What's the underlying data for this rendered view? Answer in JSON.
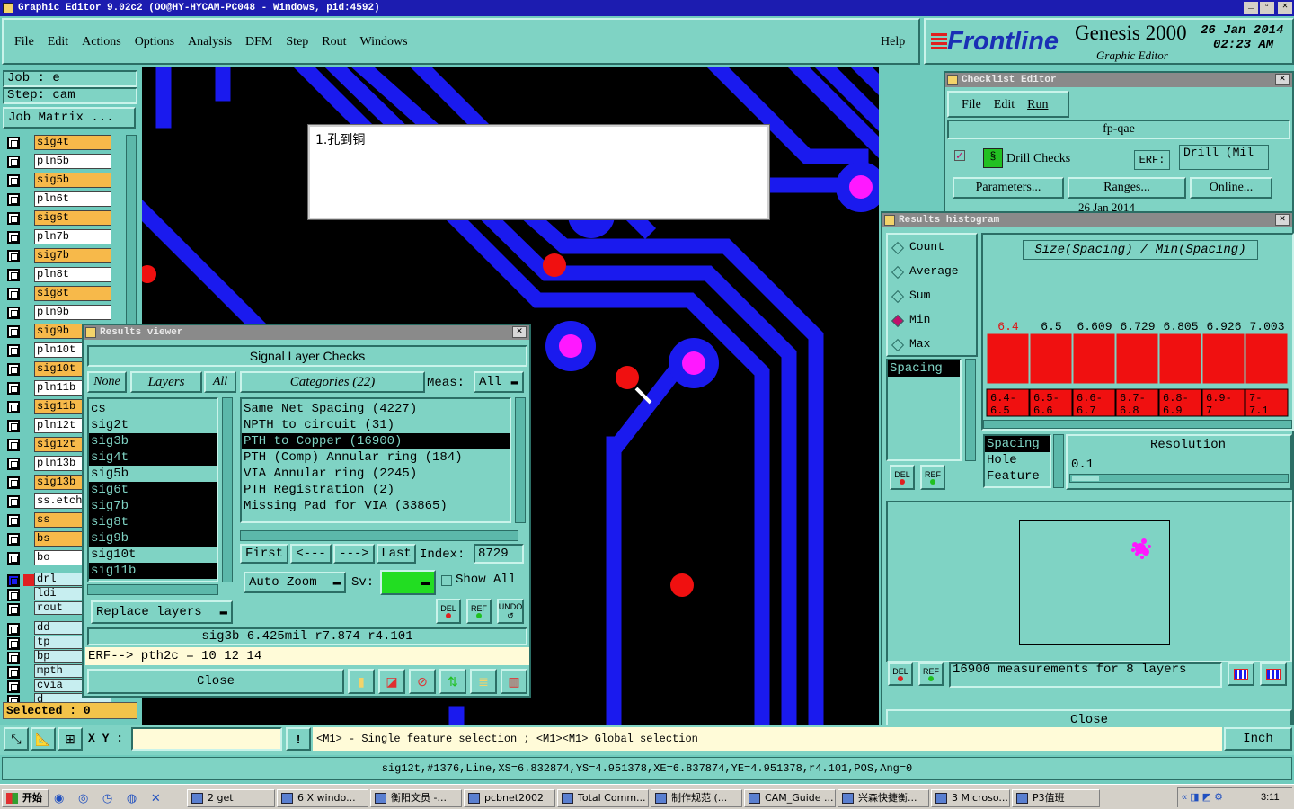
{
  "app_title": "Graphic Editor 9.02c2 (OO@HY-HYCAM-PC048 - Windows, pid:4592)",
  "menu": [
    "File",
    "Edit",
    "Actions",
    "Options",
    "Analysis",
    "DFM",
    "Step",
    "Rout",
    "Windows"
  ],
  "help": "Help",
  "brand": {
    "logo": "Frontline",
    "product": "Genesis 2000",
    "subtitle": "Graphic Editor",
    "date": "26 Jan 2014",
    "time": "02:23 AM"
  },
  "job": {
    "job": "Job  : e",
    "step": "Step: cam",
    "matrix": "Job Matrix ..."
  },
  "layers": [
    {
      "name": "sig4t",
      "aff": true
    },
    {
      "name": "pln5b"
    },
    {
      "name": "sig5b",
      "aff": true
    },
    {
      "name": "pln6t"
    },
    {
      "name": "sig6t",
      "aff": true
    },
    {
      "name": "pln7b"
    },
    {
      "name": "sig7b",
      "aff": true
    },
    {
      "name": "pln8t"
    },
    {
      "name": "sig8t",
      "aff": true
    },
    {
      "name": "pln9b"
    },
    {
      "name": "sig9b",
      "aff": true
    },
    {
      "name": "pln10t"
    },
    {
      "name": "sig10t",
      "aff": true
    },
    {
      "name": "pln11b"
    },
    {
      "name": "sig11b",
      "aff": true
    },
    {
      "name": "pln12t"
    },
    {
      "name": "sig12t",
      "aff": true
    },
    {
      "name": "pln13b"
    },
    {
      "name": "sig13b",
      "aff": true
    },
    {
      "name": "ss.etch"
    },
    {
      "name": "ss",
      "aff": true
    },
    {
      "name": "bs",
      "aff": true
    },
    {
      "name": "bo"
    }
  ],
  "layers2": [
    {
      "name": "drl"
    },
    {
      "name": "ldi"
    },
    {
      "name": "rout"
    },
    {
      "name": "dd"
    },
    {
      "name": "tp"
    },
    {
      "name": "bp"
    },
    {
      "name": "mpth"
    },
    {
      "name": "cvia"
    },
    {
      "name": "d"
    }
  ],
  "selected": "Selected : 0",
  "xy_label": "X Y :",
  "status_msg": "<M1> - Single feature selection ; <M1><M1> Global selection",
  "units": "Inch",
  "feature_line": "sig12t,#1376,Line,XS=6.832874,YS=4.951378,XE=6.837874,YE=4.951378,r4.101,POS,Ang=0",
  "note": "1.孔到铜",
  "results_viewer": {
    "title": "Results viewer",
    "header": "Signal Layer Checks",
    "none": "None",
    "layers": "Layers",
    "all": "All",
    "categories": "Categories (22)",
    "meas": "Meas:",
    "meas_val": "All",
    "layer_list": [
      {
        "n": "cs"
      },
      {
        "n": "sig2t"
      },
      {
        "n": "sig3b",
        "s": true
      },
      {
        "n": "sig4t",
        "s": true
      },
      {
        "n": "sig5b"
      },
      {
        "n": "sig6t",
        "s": true
      },
      {
        "n": "sig7b",
        "s": true
      },
      {
        "n": "sig8t",
        "s": true
      },
      {
        "n": "sig9b",
        "s": true
      },
      {
        "n": "sig10t"
      },
      {
        "n": "sig11b",
        "s": true
      }
    ],
    "cat_list": [
      {
        "n": "Same Net Spacing (4227)"
      },
      {
        "n": "NPTH to circuit (31)"
      },
      {
        "n": "PTH to Copper (16900)",
        "s": true
      },
      {
        "n": "PTH (Comp) Annular ring (184)"
      },
      {
        "n": "VIA Annular ring (2245)"
      },
      {
        "n": "PTH Registration (2)"
      },
      {
        "n": "Missing Pad for VIA (33865)"
      }
    ],
    "first": "First",
    "prev": "<---",
    "next": "--->",
    "last": "Last",
    "index_label": "Index:",
    "index_val": "8729",
    "auto_zoom": "Auto Zoom",
    "sv": "Sv:",
    "show_all": "Show All",
    "replace": "Replace layers",
    "del": "DEL",
    "ref": "REF",
    "undo": "UNDO",
    "info": "sig3b  6.425mil   r7.874   r4.101",
    "erf": "ERF--> pth2c = 10 12 14",
    "close": "Close"
  },
  "checklist": {
    "title": "Checklist Editor",
    "menu": [
      "File",
      "Edit",
      "Run"
    ],
    "name": "fp-qae",
    "check": "Drill Checks",
    "erf": "ERF:",
    "erf_val": "Drill (Mil",
    "params": "Parameters...",
    "ranges": "Ranges...",
    "online": "Online...",
    "date": "26 Jan 2014"
  },
  "histogram": {
    "title": "Results histogram",
    "modes": [
      "Count",
      "Average",
      "Sum",
      "Min",
      "Max"
    ],
    "active_mode": "Min",
    "heading": "Size(Spacing) / Min(Spacing)",
    "bar_labels": [
      "6.4",
      "6.5",
      "6.609",
      "6.729",
      "6.805",
      "6.926",
      "7.003"
    ],
    "bins": [
      [
        "6.4-",
        "6.5"
      ],
      [
        "6.5-",
        "6.6"
      ],
      [
        "6.6-",
        "6.7"
      ],
      [
        "6.7-",
        "6.8"
      ],
      [
        "6.8-",
        "6.9"
      ],
      [
        "6.9-",
        "7"
      ],
      [
        "7-",
        "7.1"
      ]
    ],
    "values": [
      1,
      1,
      1,
      1,
      1,
      1,
      1
    ],
    "attr_list": [
      "Spacing"
    ],
    "prop_list": [
      "Spacing",
      "Hole",
      "Feature"
    ],
    "resolution_label": "Resolution",
    "resolution": "0.1",
    "del": "DEL",
    "ref": "REF",
    "summary": "16900 measurements for 8 layers",
    "close": "Close"
  },
  "taskbar": {
    "start": "开始",
    "items": [
      "2 get",
      "6 X windo...",
      "衡阳文员 -...",
      "pcbnet2002",
      "Total Comm...",
      "制作规范 (...",
      "CAM_Guide ...",
      "兴森快捷衡...",
      "3 Microso...",
      "P3值班"
    ],
    "time": "3:11"
  }
}
